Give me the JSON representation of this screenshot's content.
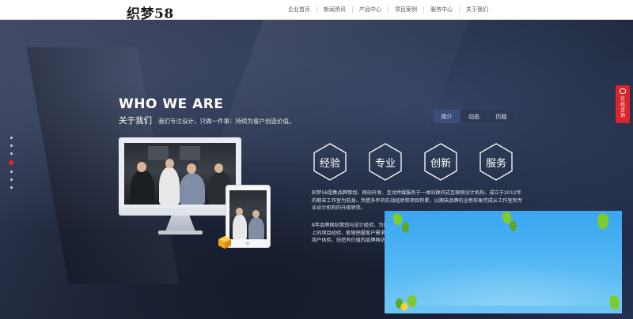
{
  "logo": {
    "text": "织梦58"
  },
  "nav": {
    "items": [
      "企业首页",
      "新闻资讯",
      "产品中心",
      "项目案例",
      "服务中心",
      "关于我们"
    ]
  },
  "hero": {
    "title_en": "WHO WE ARE",
    "title_cn": "关于我们",
    "subtitle": "我们专注设计，只做一件事：持续为客户创造价值。"
  },
  "tabs": [
    {
      "label": "简介",
      "active": true
    },
    {
      "label": "动态",
      "active": false
    },
    {
      "label": "历程",
      "active": false
    }
  ],
  "values": [
    "经验",
    "专业",
    "创新",
    "服务"
  ],
  "paragraphs": [
    "织梦58是集品牌策划、网站开发、互动传媒服务于一体的顾问式互联网设计机构，成立于2012年的期末工作室为前身。凭借多年的实战经验和项目积累，以期末品牌的全新形象完成从工作室到专业设计机构的升级转变。",
    "8年品牌网站策划与设计经验，为国内外数百家企业、机构提供了专业服务。拥有丰富的行业经验以上的项目经验，能够把握客户需求与市场趋势，为客户提供创新性的网站策划与设计，以及卓越的用户体验，创造有价值的品牌网站。"
  ],
  "side_dots": {
    "count": 7,
    "active_index": 3
  },
  "online_badge": {
    "text": "在线咨询"
  },
  "colors": {
    "accent": "#d9252b",
    "tab_active": "#3a4d78",
    "popup_sky": "#39a6f0",
    "leaf": "#7ecb2e"
  }
}
